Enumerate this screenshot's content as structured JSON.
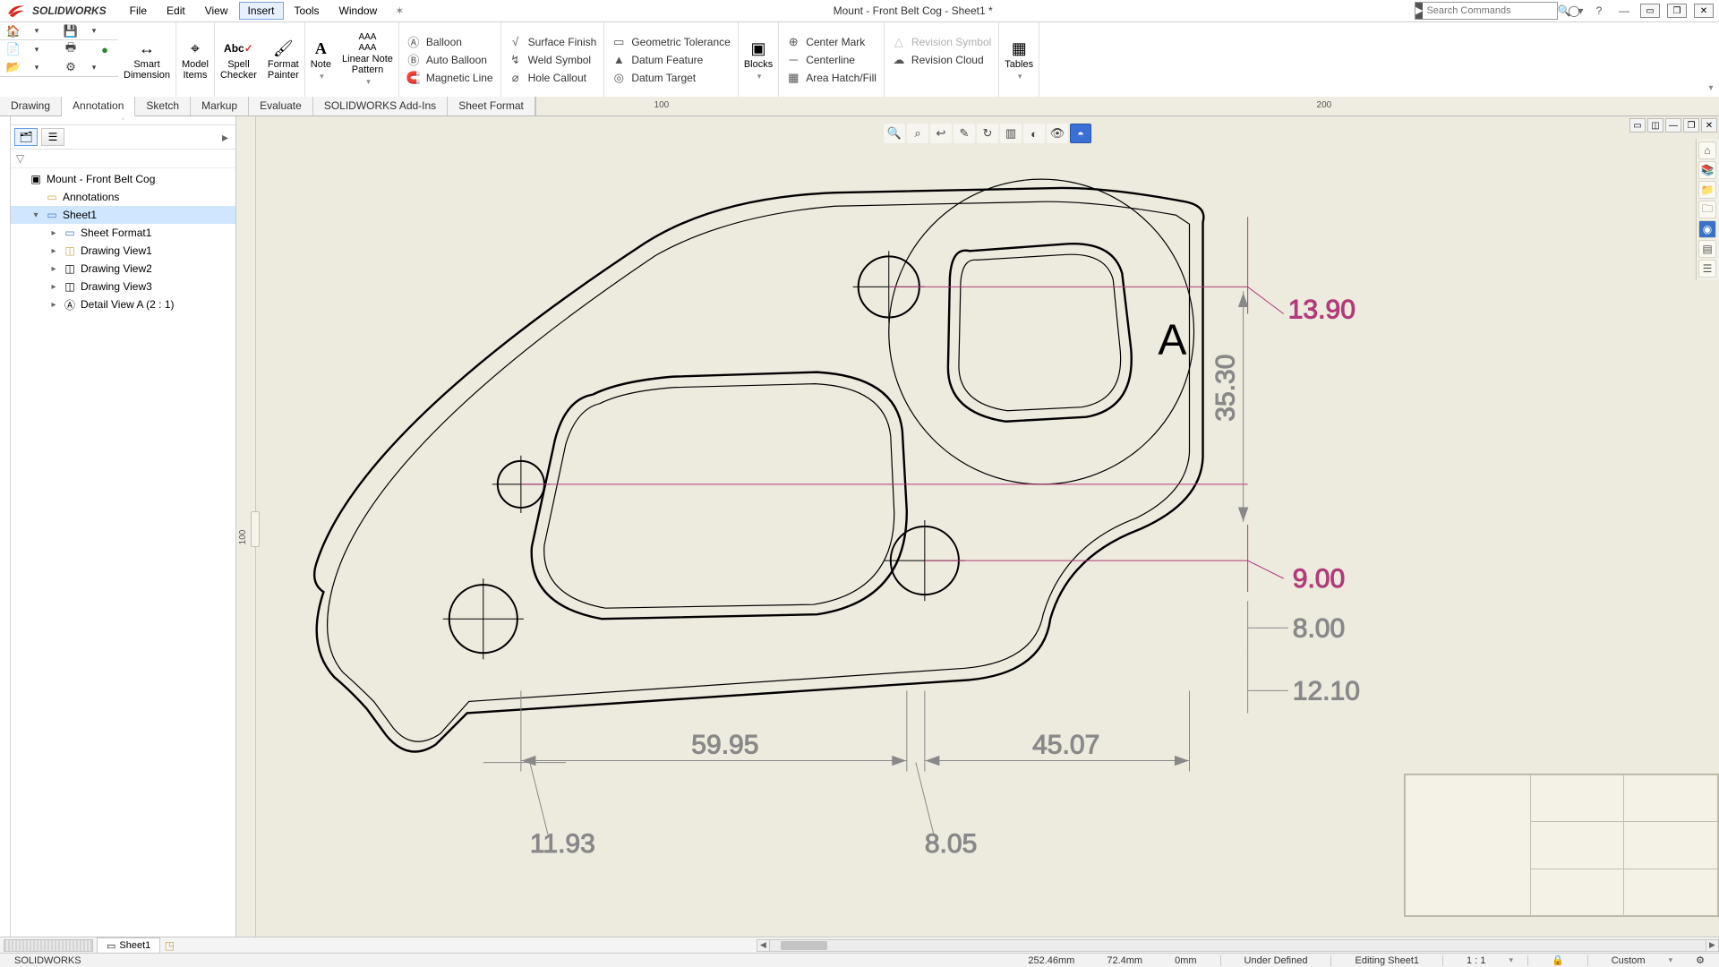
{
  "app": {
    "brand": "SOLIDWORKS",
    "title": "Mount - Front Belt Cog - Sheet1 *",
    "search_placeholder": "Search Commands"
  },
  "menu": [
    "File",
    "Edit",
    "View",
    "Insert",
    "Tools",
    "Window"
  ],
  "menu_active": "Insert",
  "ribbon": {
    "big": [
      {
        "label": "Smart\nDimension",
        "icon": "↔"
      },
      {
        "label": "Model\nItems",
        "icon": "⌖"
      },
      {
        "label": "Spell\nChecker",
        "icon": "Abc"
      },
      {
        "label": "Format\nPainter",
        "icon": "🖌"
      },
      {
        "label": "Note",
        "icon": "A"
      },
      {
        "label": "Linear Note\nPattern",
        "icon": "AAA"
      }
    ],
    "col1": [
      {
        "icon": "◯",
        "label": "Balloon"
      },
      {
        "icon": "◯",
        "label": "Auto Balloon"
      },
      {
        "icon": "🧲",
        "label": "Magnetic Line"
      }
    ],
    "col2": [
      {
        "icon": "√",
        "label": "Surface Finish"
      },
      {
        "icon": "↯",
        "label": "Weld Symbol"
      },
      {
        "icon": "⌀",
        "label": "Hole Callout"
      }
    ],
    "col3": [
      {
        "icon": "⌖",
        "label": "Geometric Tolerance"
      },
      {
        "icon": "▲",
        "label": "Datum Feature"
      },
      {
        "icon": "◎",
        "label": "Datum Target"
      }
    ],
    "big2": [
      {
        "label": "Blocks",
        "icon": "▣"
      }
    ],
    "col4": [
      {
        "icon": "⊕",
        "label": "Center Mark"
      },
      {
        "icon": "—",
        "label": "Centerline"
      },
      {
        "icon": "▦",
        "label": "Area Hatch/Fill"
      }
    ],
    "col5": [
      {
        "icon": "△",
        "label": "Revision Symbol",
        "disabled": true
      },
      {
        "icon": "☁",
        "label": "Revision Cloud"
      },
      {
        "icon": "",
        "label": ""
      }
    ],
    "big3": [
      {
        "label": "Tables",
        "icon": "▦"
      }
    ]
  },
  "tabs": [
    "Drawing",
    "Annotation",
    "Sketch",
    "Markup",
    "Evaluate",
    "SOLIDWORKS Add-Ins",
    "Sheet Format"
  ],
  "tabs_active": "Annotation",
  "ruler": {
    "h1": "100",
    "h2": "200",
    "v1": "100"
  },
  "tree": {
    "tabs_arrow": "▸",
    "root": "Mount - Front Belt Cog",
    "annotations": "Annotations",
    "sheet": "Sheet1",
    "children": [
      "Sheet Format1",
      "Drawing View1",
      "Drawing View2",
      "Drawing View3",
      "Detail View A (2 : 1)"
    ]
  },
  "dims": {
    "d1": "13.90",
    "d2": "35.30",
    "d3": "9.00",
    "d4": "8.00",
    "d5": "12.10",
    "d6": "59.95",
    "d7": "45.07",
    "d8": "11.93",
    "d9": "8.05",
    "detail": "A"
  },
  "sheet_tab": "Sheet1",
  "status": {
    "app": "SOLIDWORKS",
    "x": "252.46mm",
    "y": "72.4mm",
    "z": "0mm",
    "state": "Under Defined",
    "editing": "Editing Sheet1",
    "scale": "1 : 1",
    "units": "Custom"
  }
}
